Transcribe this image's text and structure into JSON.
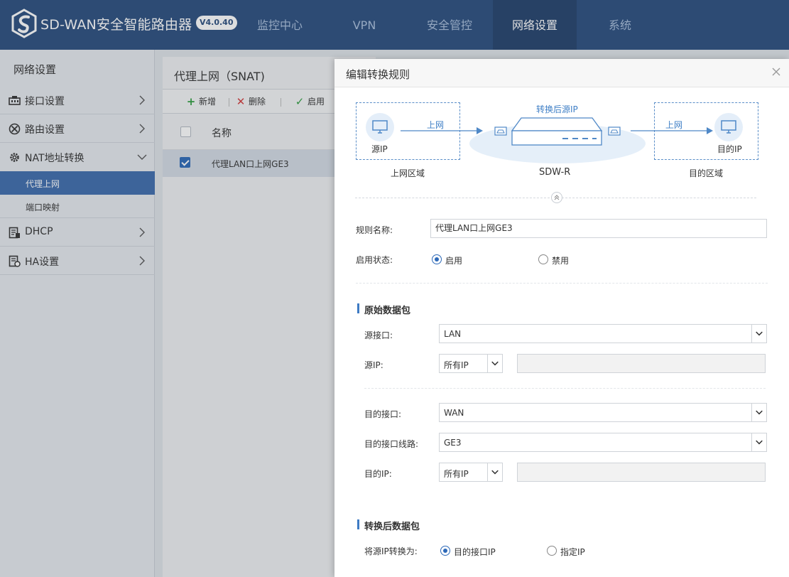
{
  "app": {
    "brand": "SD-WAN安全智能路由器",
    "version": "V4.0.40"
  },
  "nav": {
    "items": [
      "监控中心",
      "VPN",
      "安全管控",
      "网络设置",
      "系统"
    ],
    "active": "网络设置"
  },
  "sidebar": {
    "title": "网络设置",
    "items": [
      {
        "label": "接口设置",
        "icon": "interface-icon"
      },
      {
        "label": "路由设置",
        "icon": "route-icon"
      },
      {
        "label": "NAT地址转换",
        "icon": "gear-icon",
        "expanded": true,
        "children": [
          "代理上网",
          "端口映射"
        ],
        "active_child": "代理上网"
      },
      {
        "label": "DHCP",
        "icon": "dhcp-icon"
      },
      {
        "label": "HA设置",
        "icon": "ha-icon"
      }
    ]
  },
  "main": {
    "title": "代理上网（SNAT)",
    "toolbar": {
      "add": "新增",
      "delete": "删除",
      "enable": "启用"
    },
    "table": {
      "columns": [
        "名称"
      ],
      "rows": [
        {
          "name": "代理LAN口上网GE3",
          "checked": true
        }
      ]
    }
  },
  "dialog": {
    "title": "编辑转换规则",
    "diagram": {
      "source_ip": "源IP",
      "internet_left": "上网",
      "translated_ip": "转换后源IP",
      "internet_right": "上网",
      "dest_ip": "目的IP",
      "source_zone": "上网区域",
      "device": "SDW-R",
      "dest_zone": "目的区域"
    },
    "form": {
      "rule_name_label": "规则名称:",
      "rule_name_value": "代理LAN口上网GE3",
      "status_label": "启用状态:",
      "status_enable": "启用",
      "status_disable": "禁用",
      "status_value": "启用"
    },
    "original_packet": {
      "title": "原始数据包",
      "src_iface_label": "源接口:",
      "src_iface_value": "LAN",
      "src_ip_label": "源IP:",
      "src_ip_value": "所有IP",
      "dst_iface_label": "目的接口:",
      "dst_iface_value": "WAN",
      "dst_line_label": "目的接口线路:",
      "dst_line_value": "GE3",
      "dst_ip_label": "目的IP:",
      "dst_ip_value": "所有IP"
    },
    "translated_packet": {
      "title": "转换后数据包",
      "convert_label": "将源IP转换为:",
      "option_dest_iface_ip": "目的接口IP",
      "option_specified_ip": "指定IP",
      "selected": "目的接口IP"
    }
  },
  "colors": {
    "topbar": "#2a4d7e",
    "accent": "#2d69b8",
    "sidebar_active": "#3d6cad"
  }
}
